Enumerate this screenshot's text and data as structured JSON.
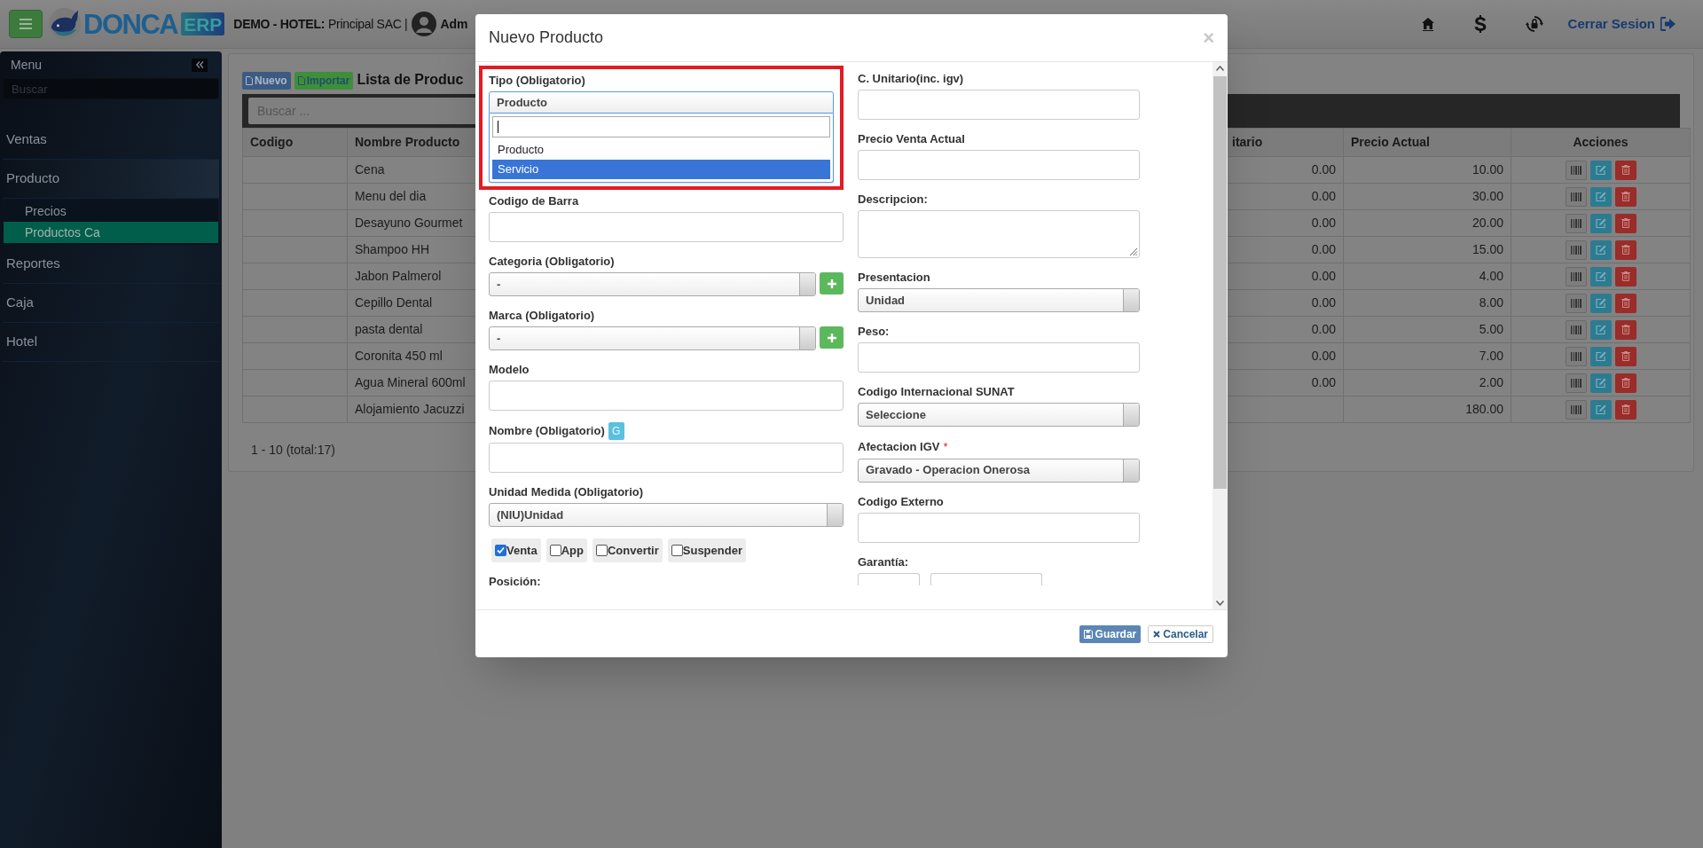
{
  "header": {
    "brand": "DONCA",
    "brand_badge": "ERP",
    "company_label": "DEMO - HOTEL:",
    "company_name": "Principal SAC |",
    "user": "Adm",
    "logout": "Cerrar Sesion"
  },
  "sidebar": {
    "title": "Menu",
    "search_placeholder": "Buscar",
    "items": [
      {
        "label": "Ventas",
        "expanded": false
      },
      {
        "label": "Producto",
        "expanded": true,
        "children": [
          {
            "label": "Precios",
            "selected": false
          },
          {
            "label": "Productos Ca",
            "selected": true
          }
        ]
      },
      {
        "label": "Reportes",
        "expanded": false
      },
      {
        "label": "Caja",
        "expanded": false
      },
      {
        "label": "Hotel",
        "expanded": false
      }
    ]
  },
  "main": {
    "buttons": [
      {
        "label": "Nuevo",
        "kind": "new"
      },
      {
        "label": "Importar",
        "kind": "import"
      }
    ],
    "title": "Lista de Produc",
    "search_placeholder": "Buscar ...",
    "table": {
      "columns": [
        "Codigo",
        "Nombre Producto",
        "",
        "itario",
        "Precio Actual",
        "Acciones"
      ],
      "rows": [
        {
          "name": "Cena",
          "column_3": "0.00",
          "price": "10.00"
        },
        {
          "name": "Menu del dia",
          "column_3": "0.00",
          "price": "30.00"
        },
        {
          "name": "Desayuno Gourmet",
          "column_3": "0.00",
          "price": "20.00"
        },
        {
          "name": "Shampoo HH",
          "column_3": "0.00",
          "price": "15.00"
        },
        {
          "name": "Jabon Palmerol",
          "column_3": "0.00",
          "price": "4.00"
        },
        {
          "name": "Cepillo Dental",
          "column_3": "0.00",
          "price": "8.00"
        },
        {
          "name": "pasta dental",
          "column_3": "0.00",
          "price": "5.00"
        },
        {
          "name": "Coronita 450 ml",
          "column_3": "0.00",
          "price": "7.00"
        },
        {
          "name": "Agua Mineral 600ml",
          "column_3": "0.00",
          "price": "2.00"
        },
        {
          "name": "Alojamiento Jacuzzi",
          "column_3": "",
          "price": "180.00"
        }
      ]
    },
    "pagination": "1 - 10 (total:17)"
  },
  "modal": {
    "title": "Nuevo Producto",
    "close": "×",
    "left_fields": [
      {
        "kind": "select_open",
        "label": "Tipo (Obligatorio)",
        "value": "Producto",
        "highlighted": true,
        "options": [
          {
            "label": "Producto",
            "highlighted": false
          },
          {
            "label": "Servicio",
            "highlighted": true
          }
        ]
      },
      {
        "kind": "input",
        "label": "Codigo de Barra"
      },
      {
        "kind": "select_add",
        "label": "Categoria (Obligatorio)",
        "value": "-"
      },
      {
        "kind": "select_add",
        "label": "Marca (Obligatorio)",
        "value": "-"
      },
      {
        "kind": "input",
        "label": "Modelo"
      },
      {
        "kind": "input",
        "label": "Nombre (Obligatorio)",
        "badge": "G"
      },
      {
        "kind": "select",
        "label": "Unidad Medida (Obligatorio)",
        "value": "(NIU)Unidad"
      },
      {
        "kind": "checkboxes",
        "options": [
          {
            "label": "Venta",
            "checked": true
          },
          {
            "label": "App",
            "checked": false
          },
          {
            "label": "Convertir",
            "checked": false
          },
          {
            "label": "Suspender",
            "checked": false
          }
        ]
      },
      {
        "kind": "label_only",
        "label": "Posición:"
      }
    ],
    "right_fields": [
      {
        "kind": "input",
        "label": "C. Unitario(inc. igv)"
      },
      {
        "kind": "input",
        "label": "Precio Venta Actual"
      },
      {
        "kind": "textarea",
        "label": "Descripcion:"
      },
      {
        "kind": "select",
        "label": "Presentacion",
        "value": "Unidad"
      },
      {
        "kind": "input",
        "label": "Peso:"
      },
      {
        "kind": "select",
        "label": "Codigo Internacional SUNAT",
        "value": "Seleccione"
      },
      {
        "kind": "select",
        "label": "Afectacion IGV",
        "required_mark": "*",
        "value": "Gravado - Operacion Onerosa"
      },
      {
        "kind": "input",
        "label": "Codigo Externo"
      },
      {
        "kind": "input_pair",
        "label": "Garantía:"
      }
    ],
    "buttons": [
      {
        "label": "Guardar",
        "kind": "save"
      },
      {
        "label": "Cancelar",
        "kind": "cancel"
      }
    ]
  }
}
